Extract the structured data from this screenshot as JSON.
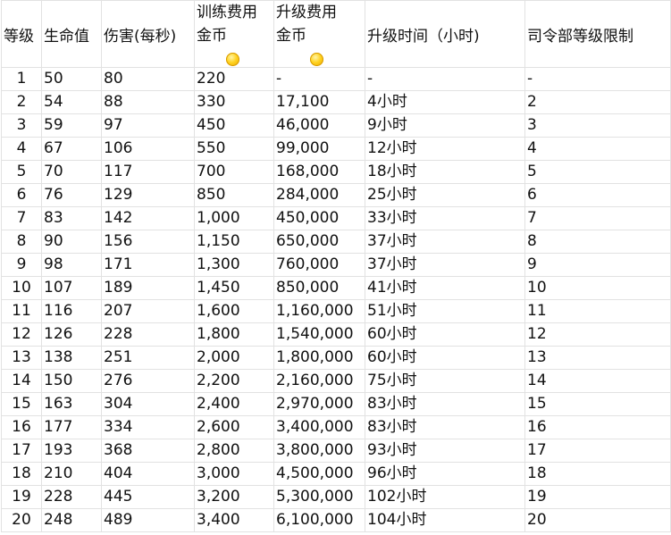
{
  "header": {
    "level": "等级",
    "hp": "生命值",
    "dps": "伤害(每秒)",
    "train_cost_title": "训练费用",
    "train_cost_unit": "金币",
    "upgrade_cost_title": "升级费用",
    "upgrade_cost_unit": "金币",
    "upgrade_time": "升级时间（小时)",
    "hq_level": "司令部等级限制",
    "coin_icon": "gold-coin-icon",
    "coin_color": "#ffd21f"
  },
  "rows": [
    {
      "level": "1",
      "hp": "50",
      "dps": "80",
      "train": "220",
      "upgrade": "-",
      "time": "-",
      "hq": "-"
    },
    {
      "level": "2",
      "hp": "54",
      "dps": "88",
      "train": "330",
      "upgrade": "17,100",
      "time": "4小时",
      "hq": "2"
    },
    {
      "level": "3",
      "hp": "59",
      "dps": "97",
      "train": "450",
      "upgrade": "46,000",
      "time": "9小时",
      "hq": "3"
    },
    {
      "level": "4",
      "hp": "67",
      "dps": "106",
      "train": "550",
      "upgrade": "99,000",
      "time": "12小时",
      "hq": "4"
    },
    {
      "level": "5",
      "hp": "70",
      "dps": "117",
      "train": "700",
      "upgrade": "168,000",
      "time": "18小时",
      "hq": "5"
    },
    {
      "level": "6",
      "hp": "76",
      "dps": "129",
      "train": "850",
      "upgrade": "284,000",
      "time": "25小时",
      "hq": "6"
    },
    {
      "level": "7",
      "hp": "83",
      "dps": "142",
      "train": "1,000",
      "upgrade": "450,000",
      "time": "33小时",
      "hq": "7"
    },
    {
      "level": "8",
      "hp": "90",
      "dps": "156",
      "train": "1,150",
      "upgrade": "650,000",
      "time": "37小时",
      "hq": "8"
    },
    {
      "level": "9",
      "hp": "98",
      "dps": "171",
      "train": "1,300",
      "upgrade": "760,000",
      "time": "37小时",
      "hq": "9"
    },
    {
      "level": "10",
      "hp": "107",
      "dps": "189",
      "train": "1,450",
      "upgrade": "850,000",
      "time": "41小时",
      "hq": "10"
    },
    {
      "level": "11",
      "hp": "116",
      "dps": "207",
      "train": "1,600",
      "upgrade": "1,160,000",
      "time": "51小时",
      "hq": "11"
    },
    {
      "level": "12",
      "hp": "126",
      "dps": "228",
      "train": "1,800",
      "upgrade": "1,540,000",
      "time": "60小时",
      "hq": "12"
    },
    {
      "level": "13",
      "hp": "138",
      "dps": "251",
      "train": "2,000",
      "upgrade": "1,800,000",
      "time": "60小时",
      "hq": "13"
    },
    {
      "level": "14",
      "hp": "150",
      "dps": "276",
      "train": "2,200",
      "upgrade": "2,160,000",
      "time": "75小时",
      "hq": "14"
    },
    {
      "level": "15",
      "hp": "163",
      "dps": "304",
      "train": "2,400",
      "upgrade": "2,970,000",
      "time": "83小时",
      "hq": "15"
    },
    {
      "level": "16",
      "hp": "177",
      "dps": "334",
      "train": "2,600",
      "upgrade": "3,400,000",
      "time": "83小时",
      "hq": "16"
    },
    {
      "level": "17",
      "hp": "193",
      "dps": "368",
      "train": "2,800",
      "upgrade": "3,800,000",
      "time": "93小时",
      "hq": "17"
    },
    {
      "level": "18",
      "hp": "210",
      "dps": "404",
      "train": "3,000",
      "upgrade": "4,500,000",
      "time": "96小时",
      "hq": "18"
    },
    {
      "level": "19",
      "hp": "228",
      "dps": "445",
      "train": "3,200",
      "upgrade": "5,300,000",
      "time": "102小时",
      "hq": "19"
    },
    {
      "level": "20",
      "hp": "248",
      "dps": "489",
      "train": "3,400",
      "upgrade": "6,100,000",
      "time": "104小时",
      "hq": "20"
    }
  ]
}
